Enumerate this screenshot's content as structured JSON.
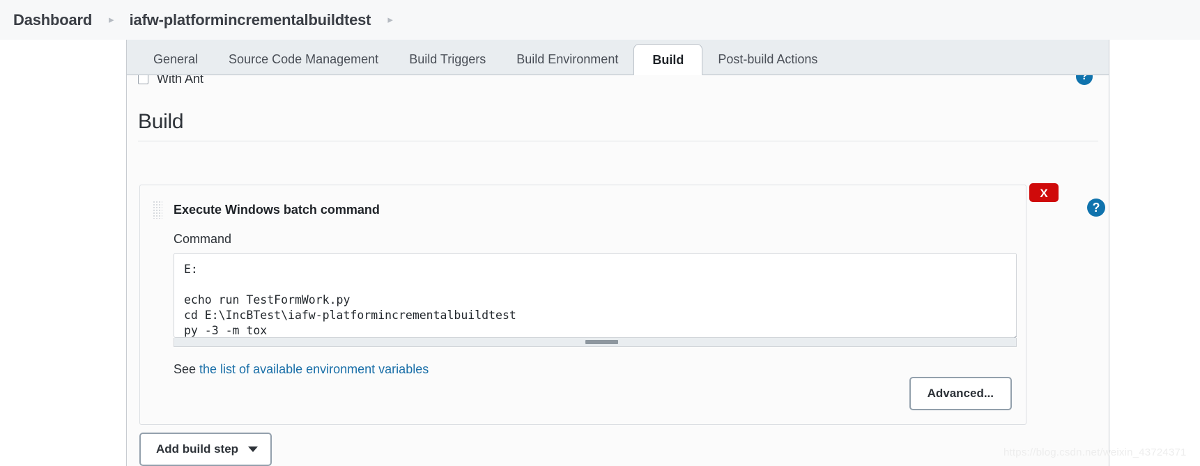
{
  "breadcrumb": {
    "items": [
      {
        "label": "Dashboard"
      },
      {
        "label": "iafw-platformincrementalbuildtest"
      }
    ],
    "separator": "▸"
  },
  "tabs": [
    {
      "label": "General",
      "active": false
    },
    {
      "label": "Source Code Management",
      "active": false
    },
    {
      "label": "Build Triggers",
      "active": false
    },
    {
      "label": "Build Environment",
      "active": false
    },
    {
      "label": "Build",
      "active": true
    },
    {
      "label": "Post-build Actions",
      "active": false
    }
  ],
  "clipped_row": {
    "label": "With Ant",
    "help_label": "?"
  },
  "section": {
    "title": "Build"
  },
  "build_step": {
    "title": "Execute Windows batch command",
    "command_label": "Command",
    "command_value": "E:\n\necho run TestFormWork.py\ncd E:\\IncBTest\\iafw-platformincrementalbuildtest\npy -3 -m tox",
    "env_prefix": "See ",
    "env_link_text": "the list of available environment variables",
    "advanced_label": "Advanced...",
    "delete_label": "X",
    "help_label": "?"
  },
  "footer": {
    "add_build_step_label": "Add build step"
  },
  "watermark": {
    "text": "https://blog.csdn.net/weixin_43724371"
  },
  "colors": {
    "accent_link": "#1a6fa8",
    "danger": "#cf0a0a",
    "help_blue": "#1073ad",
    "tabbar_bg": "#e9edf0",
    "panel_bg": "#fbfbfb"
  }
}
